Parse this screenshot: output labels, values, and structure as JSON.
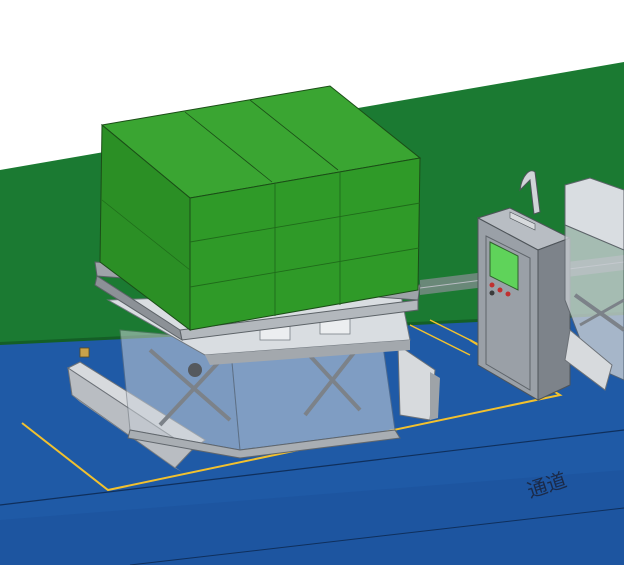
{
  "scene": {
    "floor_text": "通道",
    "colors": {
      "background": "#ffffff",
      "floor": "#1f5aa6",
      "floor_dark": "#1c4f92",
      "wall": "#1b7a32",
      "wall_dark": "#166a2a",
      "cargo": "#2e9a2a",
      "cargo_dark": "#237a20",
      "frame": "#cfd3d8",
      "frame_dark": "#7f858c",
      "cabinet": "#9aa0a7",
      "cabinet_dark": "#6b7178",
      "screen": "#5fd35a",
      "marking_yellow": "#f2c12e"
    },
    "icons": {
      "cabinet_screen": "display-screen-icon",
      "cabinet_buttons": "control-buttons-icon"
    }
  }
}
